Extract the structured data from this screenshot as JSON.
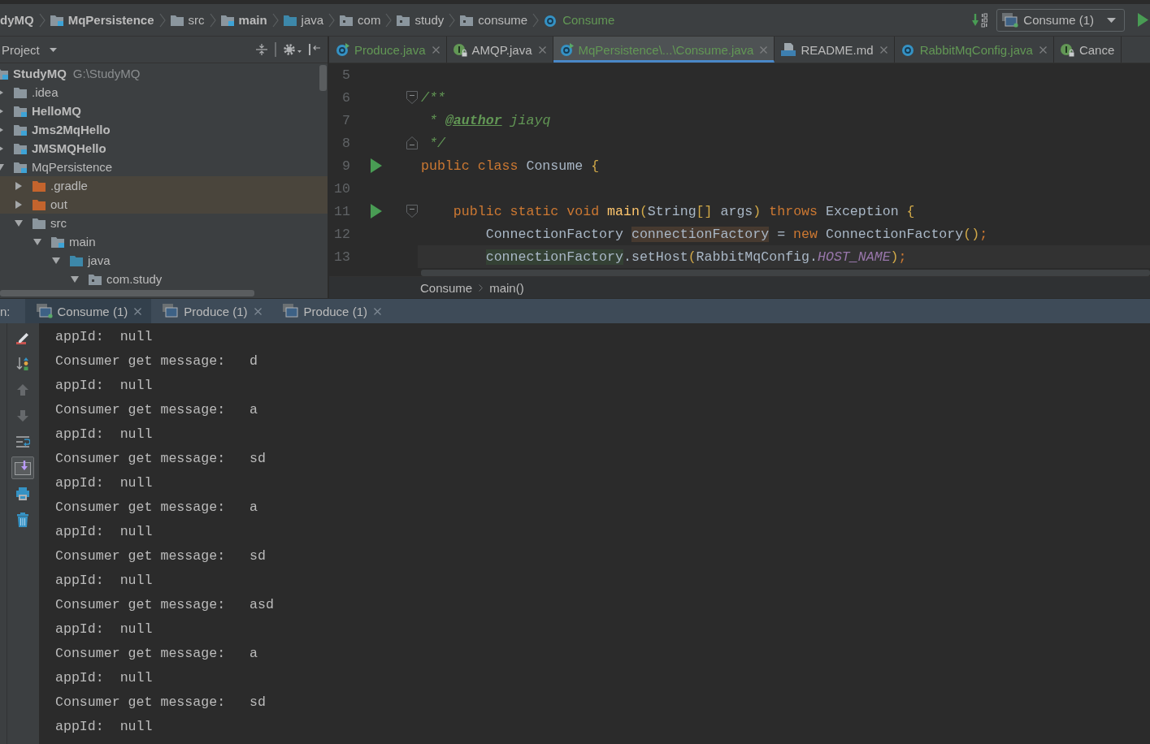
{
  "top_bar": {
    "breadcrumbs": [
      {
        "label": "dyMQ",
        "kind": "root"
      },
      {
        "label": "MqPersistence",
        "kind": "module"
      },
      {
        "label": "src",
        "kind": "folder"
      },
      {
        "label": "main",
        "kind": "module"
      },
      {
        "label": "java",
        "kind": "source-root"
      },
      {
        "label": "com",
        "kind": "package"
      },
      {
        "label": "study",
        "kind": "package"
      },
      {
        "label": "consume",
        "kind": "package"
      },
      {
        "label": "Consume",
        "kind": "class"
      }
    ],
    "run_config": {
      "label": "Consume (1)",
      "running": true
    }
  },
  "project_panel": {
    "title": "Project",
    "tree": [
      {
        "label": "StudyMQ",
        "path": "G:\\StudyMQ",
        "kind": "module",
        "bold": true,
        "excluded": false,
        "children": [
          {
            "label": ".idea",
            "kind": "folder",
            "bold": false,
            "expanded": false,
            "excluded": false
          },
          {
            "label": "HelloMQ",
            "kind": "module",
            "bold": true,
            "expanded": false,
            "excluded": false
          },
          {
            "label": "Jms2MqHello",
            "kind": "module",
            "bold": true,
            "expanded": false,
            "excluded": false
          },
          {
            "label": "JMSMQHello",
            "kind": "module",
            "bold": true,
            "expanded": false,
            "excluded": false
          },
          {
            "label": "MqPersistence",
            "kind": "module",
            "bold": false,
            "expanded": true,
            "excluded": false,
            "children": [
              {
                "label": ".gradle",
                "kind": "folder",
                "bold": false,
                "expanded": false,
                "excluded": true
              },
              {
                "label": "out",
                "kind": "folder",
                "bold": false,
                "expanded": false,
                "excluded": true
              },
              {
                "label": "src",
                "kind": "folder",
                "bold": false,
                "expanded": true,
                "excluded": false,
                "children": [
                  {
                    "label": "main",
                    "kind": "module",
                    "bold": false,
                    "expanded": true,
                    "excluded": false,
                    "children": [
                      {
                        "label": "java",
                        "kind": "source-root",
                        "bold": false,
                        "expanded": true,
                        "excluded": false,
                        "children": [
                          {
                            "label": "com.study",
                            "kind": "package",
                            "bold": false,
                            "expanded": true,
                            "excluded": false
                          }
                        ]
                      }
                    ]
                  }
                ]
              }
            ]
          }
        ]
      }
    ]
  },
  "editor": {
    "tabs": [
      {
        "label": "Produce.java",
        "kind": "main-class",
        "color": "#629755",
        "selected": false,
        "closable": true
      },
      {
        "label": "AMQP.java",
        "kind": "locked-interface",
        "color": "#bbbbbb",
        "selected": false,
        "closable": true
      },
      {
        "label": "MqPersistence\\...\\Consume.java",
        "kind": "main-class",
        "color": "#629755",
        "selected": true,
        "closable": true
      },
      {
        "label": "README.md",
        "kind": "markdown",
        "color": "#bbbbbb",
        "selected": false,
        "closable": true
      },
      {
        "label": "RabbitMqConfig.java",
        "kind": "class",
        "color": "#629755",
        "selected": false,
        "closable": true
      },
      {
        "label": "Cance",
        "kind": "locked-interface",
        "color": "#bbbbbb",
        "selected": false,
        "closable": false
      }
    ],
    "lines": [
      {
        "number": "5",
        "run": false,
        "current": false,
        "fold_start": false,
        "fold_end": false
      },
      {
        "number": "6",
        "run": false,
        "current": false,
        "fold_start": true,
        "fold_end": false,
        "code": [
          {
            "text": "/**",
            "kind": "comment"
          }
        ]
      },
      {
        "number": "7",
        "run": false,
        "current": false,
        "fold_start": false,
        "fold_end": false,
        "code": [
          {
            "text": " * ",
            "kind": "comment"
          },
          {
            "text": "@author",
            "kind": "doctag"
          },
          {
            "text": " jiayq",
            "kind": "comment"
          }
        ]
      },
      {
        "number": "8",
        "run": false,
        "current": false,
        "fold_start": false,
        "fold_end": true,
        "code": [
          {
            "text": " */",
            "kind": "comment"
          }
        ]
      },
      {
        "number": "9",
        "run": true,
        "current": false,
        "fold_start": false,
        "fold_end": false,
        "code": [
          {
            "text": "public class",
            "kind": "keyword"
          },
          {
            "text": " Consume ",
            "kind": "plain"
          },
          {
            "text": "{",
            "kind": "bracket"
          }
        ]
      },
      {
        "number": "10",
        "run": false,
        "current": false,
        "fold_start": false,
        "fold_end": false
      },
      {
        "number": "11",
        "run": true,
        "current": false,
        "fold_start": true,
        "fold_end": false,
        "code": [
          {
            "text": "    public static void ",
            "kind": "keyword"
          },
          {
            "text": "main",
            "kind": "method"
          },
          {
            "text": "(",
            "kind": "bracket"
          },
          {
            "text": "String",
            "kind": "plain"
          },
          {
            "text": "[]",
            "kind": "bracket"
          },
          {
            "text": " args",
            "kind": "plain"
          },
          {
            "text": ")",
            "kind": "bracket"
          },
          {
            "text": " throws",
            "kind": "keyword"
          },
          {
            "text": " Exception ",
            "kind": "plain"
          },
          {
            "text": "{",
            "kind": "bracket"
          }
        ]
      },
      {
        "number": "12",
        "run": false,
        "current": false,
        "fold_start": false,
        "fold_end": false,
        "code": [
          {
            "text": "        ConnectionFactory ",
            "kind": "plain"
          },
          {
            "text": "connectionFactory",
            "kind": "local-decl"
          },
          {
            "text": " = ",
            "kind": "plain"
          },
          {
            "text": "new",
            "kind": "keyword"
          },
          {
            "text": " ConnectionFactory",
            "kind": "plain"
          },
          {
            "text": "()",
            "kind": "bracket"
          },
          {
            "text": ";",
            "kind": "keyword"
          }
        ]
      },
      {
        "number": "13",
        "run": false,
        "current": true,
        "fold_start": false,
        "fold_end": false,
        "code": [
          {
            "text": "        connectionFactory",
            "kind": "local-usage"
          },
          {
            "text": ".setHost",
            "kind": "plain"
          },
          {
            "text": "(",
            "kind": "bracket"
          },
          {
            "text": "RabbitMqConfig.",
            "kind": "plain"
          },
          {
            "text": "HOST_NAME",
            "kind": "constant"
          },
          {
            "text": ")",
            "kind": "bracket"
          },
          {
            "text": ";",
            "kind": "keyword"
          }
        ]
      }
    ],
    "breadcrumbs": [
      "Consume",
      "main()"
    ]
  },
  "run_panel": {
    "label": "n:",
    "tabs": [
      {
        "label": "Consume (1)",
        "selected": true,
        "running": true
      },
      {
        "label": "Produce (1)",
        "selected": false,
        "running": false
      },
      {
        "label": "Produce (1)",
        "selected": false,
        "running": false
      }
    ],
    "toolbar": [
      {
        "kind": "pencil",
        "disabled": false,
        "toggled": false
      },
      {
        "kind": "sort",
        "disabled": false,
        "toggled": false
      },
      {
        "kind": "up",
        "disabled": true,
        "toggled": false
      },
      {
        "kind": "down",
        "disabled": true,
        "toggled": false
      },
      {
        "kind": "wrap",
        "disabled": false,
        "toggled": false
      },
      {
        "kind": "scroll-end",
        "disabled": false,
        "toggled": true
      },
      {
        "kind": "print",
        "disabled": false,
        "toggled": false
      },
      {
        "kind": "trash",
        "disabled": false,
        "toggled": false
      }
    ],
    "output": [
      "appId:  null",
      "Consumer get message:   d",
      "appId:  null",
      "Consumer get message:   a",
      "appId:  null",
      "Consumer get message:   sd",
      "appId:  null",
      "Consumer get message:   a",
      "appId:  null",
      "Consumer get message:   sd",
      "appId:  null",
      "Consumer get message:   asd",
      "appId:  null",
      "Consumer get message:   a",
      "appId:  null",
      "Consumer get message:   sd",
      "appId:  null"
    ]
  }
}
